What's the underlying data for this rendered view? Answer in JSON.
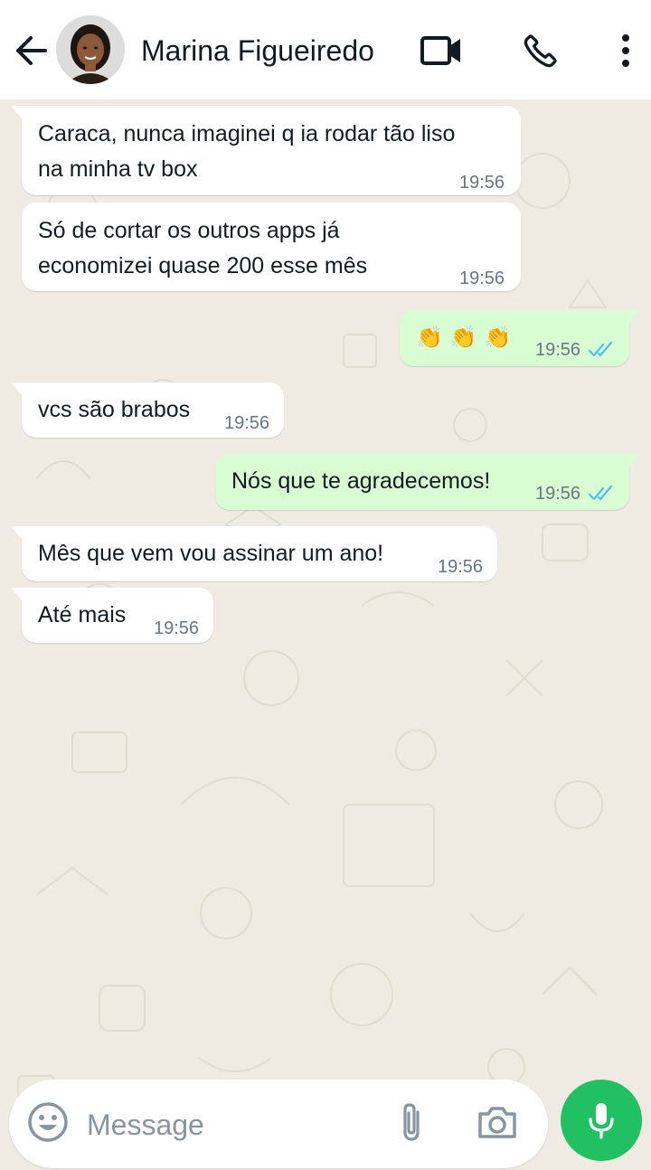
{
  "header": {
    "contact_name": "Marina Figueiredo",
    "icons": [
      "back-arrow-icon",
      "video-call-icon",
      "phone-call-icon",
      "more-options-icon"
    ]
  },
  "messages": [
    {
      "direction": "incoming",
      "text": "Caraca, nunca imaginei q ia rodar tão liso\nna minha tv box",
      "time": "19:56"
    },
    {
      "direction": "incoming",
      "text": "Só de cortar os outros apps já\neconomizei quase 200 esse mês",
      "time": "19:56"
    },
    {
      "direction": "outgoing",
      "text": "👏👏👏",
      "time": "19:56",
      "status": "read"
    },
    {
      "direction": "incoming",
      "text": "vcs são brabos",
      "time": "19:56"
    },
    {
      "direction": "outgoing",
      "text": "Nós que te agradecemos!",
      "time": "19:56",
      "status": "read"
    },
    {
      "direction": "incoming",
      "text": "Mês que vem vou assinar um ano!",
      "time": "19:56"
    },
    {
      "direction": "incoming",
      "text": "Até mais",
      "time": "19:56"
    }
  ],
  "composer": {
    "placeholder": "Message",
    "icons": [
      "emoji-icon",
      "paperclip-icon",
      "camera-icon",
      "microphone-icon"
    ]
  },
  "colors": {
    "incoming_bubble": "#ffffff",
    "outgoing_bubble": "#d9fdd3",
    "wallpaper": "#efeae2",
    "read_ticks": "#53bdeb",
    "mic_button": "#21c063"
  }
}
